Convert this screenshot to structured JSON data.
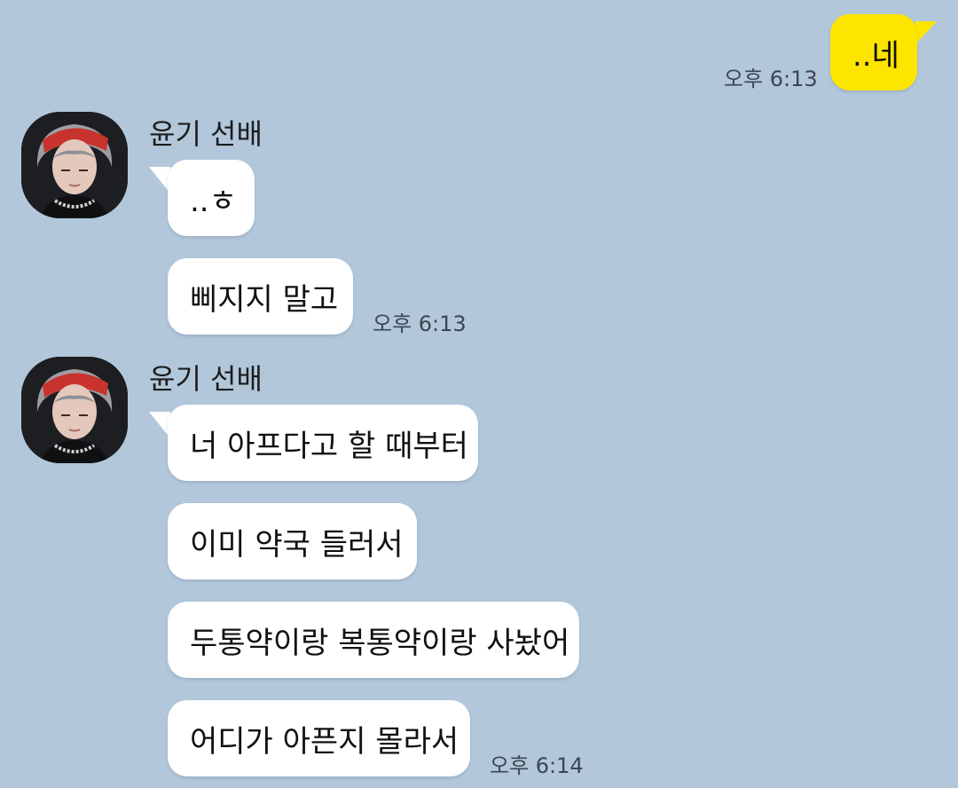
{
  "colors": {
    "background": "#b2c7da",
    "my_bubble": "#fee500",
    "their_bubble": "#ffffff"
  },
  "my_message": {
    "text": "..네",
    "time": "오후 6:13"
  },
  "groups": [
    {
      "sender": "윤기 선배",
      "avatar_icon": "profile-photo-icon",
      "messages": [
        {
          "text": "..ㅎ"
        },
        {
          "text": "삐지지 말고",
          "time": "오후 6:13"
        }
      ]
    },
    {
      "sender": "윤기 선배",
      "avatar_icon": "profile-photo-icon",
      "messages": [
        {
          "text": "너 아프다고 할 때부터"
        },
        {
          "text": "이미 약국 들러서"
        },
        {
          "text": "두통약이랑 복통약이랑 사놨어"
        },
        {
          "text": "어디가 아픈지 몰라서",
          "time": "오후 6:14"
        }
      ]
    }
  ]
}
